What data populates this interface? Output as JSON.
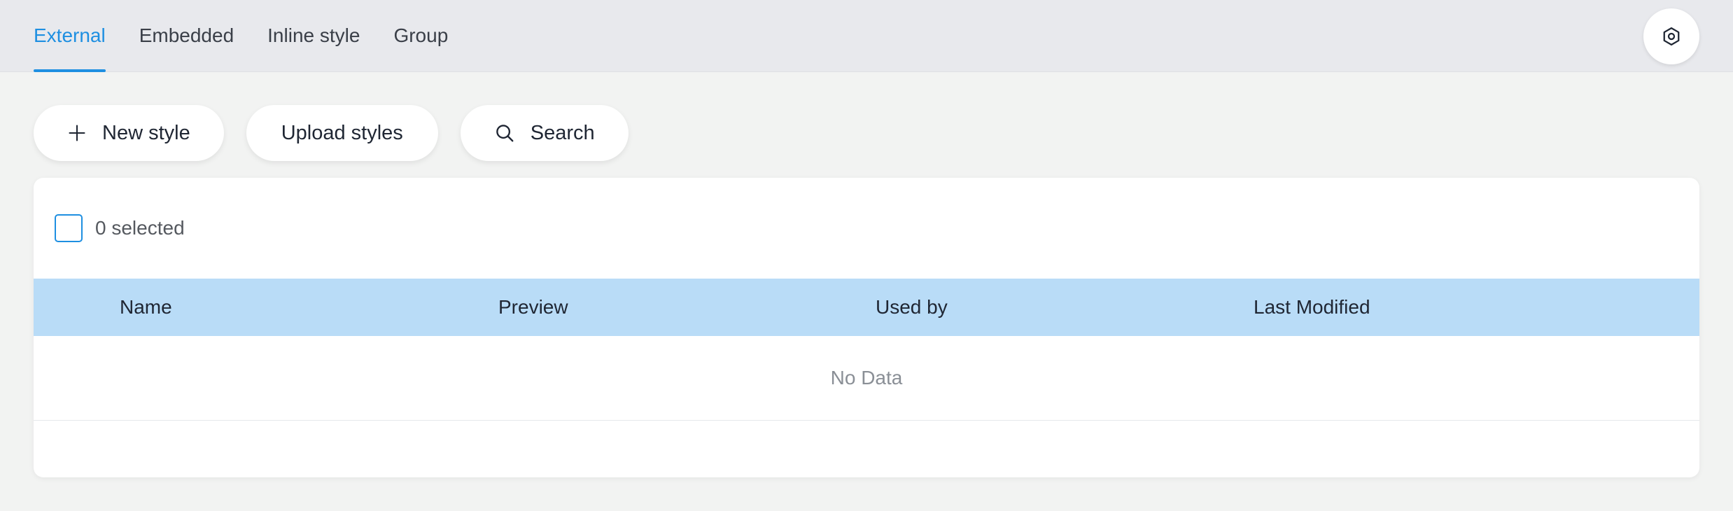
{
  "tabs": [
    {
      "label": "External",
      "active": true
    },
    {
      "label": "Embedded",
      "active": false
    },
    {
      "label": "Inline style",
      "active": false
    },
    {
      "label": "Group",
      "active": false
    }
  ],
  "settings": {
    "icon": "gear-icon"
  },
  "toolbar": {
    "new_style_label": "New style",
    "new_style_icon": "plus-icon",
    "upload_label": "Upload styles",
    "search_label": "Search",
    "search_icon": "search-icon"
  },
  "table": {
    "selection_text": "0 selected",
    "columns": [
      "Name",
      "Preview",
      "Used by",
      "Last Modified"
    ],
    "empty_text": "No Data"
  },
  "colors": {
    "accent": "#1e8fe1",
    "header_bg": "#b9dcf7",
    "topbar_bg": "#e8e9ed",
    "page_bg": "#f2f3f2"
  }
}
